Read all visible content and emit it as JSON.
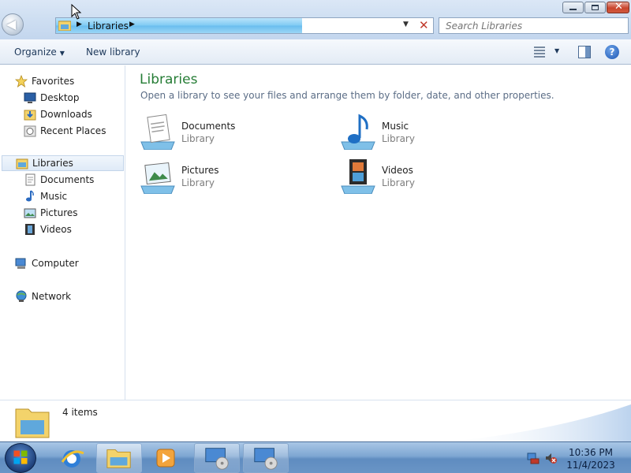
{
  "window": {
    "address_crumb": "Libraries",
    "search_placeholder": "Search Libraries"
  },
  "toolbar": {
    "organize_label": "Organize",
    "new_library_label": "New library"
  },
  "nav": {
    "favorites": {
      "label": "Favorites",
      "items": [
        "Desktop",
        "Downloads",
        "Recent Places"
      ]
    },
    "libraries": {
      "label": "Libraries",
      "items": [
        "Documents",
        "Music",
        "Pictures",
        "Videos"
      ]
    },
    "computer_label": "Computer",
    "network_label": "Network"
  },
  "content": {
    "title": "Libraries",
    "subtitle": "Open a library to see your files and arrange them by folder, date, and other properties.",
    "libraries": [
      {
        "name": "Documents",
        "type": "Library",
        "icon": "documents-library-icon"
      },
      {
        "name": "Music",
        "type": "Library",
        "icon": "music-library-icon"
      },
      {
        "name": "Pictures",
        "type": "Library",
        "icon": "pictures-library-icon"
      },
      {
        "name": "Videos",
        "type": "Library",
        "icon": "videos-library-icon"
      }
    ]
  },
  "details": {
    "item_count": "4 items"
  },
  "taskbar": {
    "time": "10:36 PM",
    "date": "11/4/2023"
  },
  "colors": {
    "title_green": "#267d36",
    "link_blue": "#1e395b",
    "subtitle_gray": "#5b6d86"
  }
}
